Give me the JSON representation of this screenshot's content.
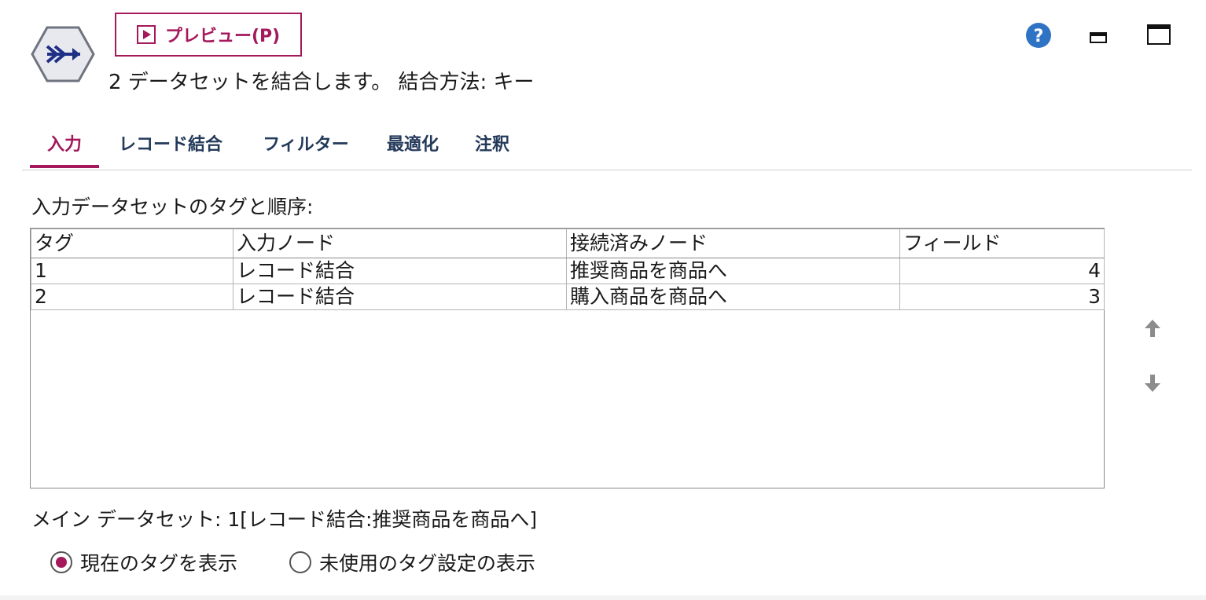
{
  "toolbar": {
    "preview_label": "プレビュー(P)"
  },
  "header": {
    "subtitle": "2 データセットを結合します。 結合方法: キー"
  },
  "tabs": [
    {
      "label": "入力",
      "active": true
    },
    {
      "label": "レコード結合",
      "active": false
    },
    {
      "label": "フィルター",
      "active": false
    },
    {
      "label": "最適化",
      "active": false
    },
    {
      "label": "注釈",
      "active": false
    }
  ],
  "inputs": {
    "section_label": "入力データセットのタグと順序:",
    "columns": [
      "タグ",
      "入力ノード",
      "接続済みノード",
      "フィールド"
    ],
    "rows": [
      {
        "tag": "1",
        "input_node": "レコード結合",
        "connected_node": "推奨商品を商品へ",
        "fields": "4"
      },
      {
        "tag": "2",
        "input_node": "レコード結合",
        "connected_node": "購入商品を商品へ",
        "fields": "3"
      }
    ],
    "main_dataset": "メイン データセット: 1[レコード結合:推奨商品を商品へ]"
  },
  "options": {
    "show_current_tags": "現在のタグを表示",
    "show_unused_tags": "未使用のタグ設定の表示",
    "selected": "show_current_tags"
  },
  "icons": {
    "node": "merge-node-icon",
    "help": "help-icon",
    "minimize": "minimize-icon",
    "maximize": "maximize-icon",
    "move_up": "arrow-up-icon",
    "move_down": "arrow-down-icon"
  },
  "colors": {
    "accent": "#a3195b",
    "tab_text": "#243a5a",
    "help_blue": "#2f73c4",
    "node_navy": "#1d2f86"
  }
}
